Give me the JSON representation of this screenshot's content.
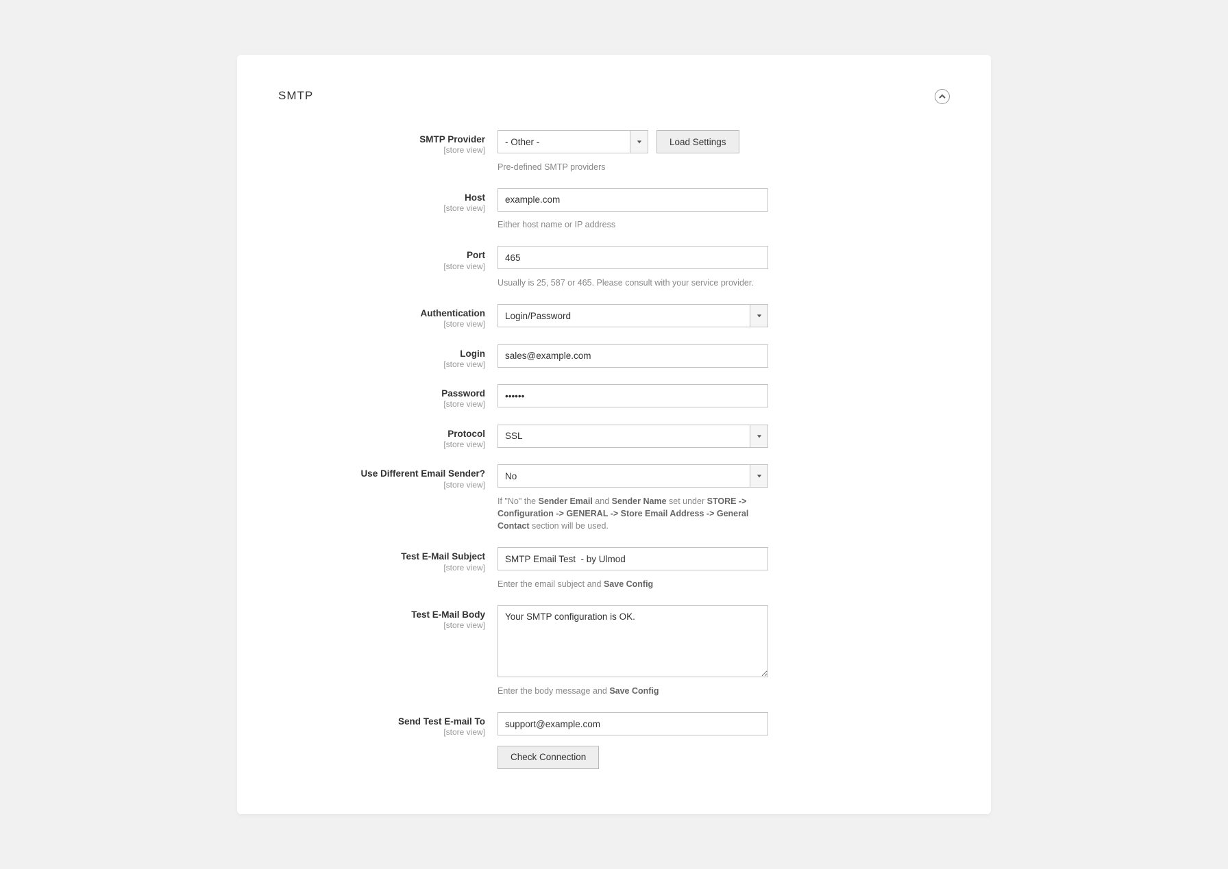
{
  "section": {
    "title": "SMTP"
  },
  "scope_label": "[store view]",
  "fields": {
    "provider": {
      "label": "SMTP Provider",
      "value": "- Other -",
      "help": "Pre-defined SMTP providers",
      "load_button": "Load Settings"
    },
    "host": {
      "label": "Host",
      "value": "example.com",
      "help": "Either host name or IP address"
    },
    "port": {
      "label": "Port",
      "value": "465",
      "help": "Usually is 25, 587 or 465. Please consult with your service provider."
    },
    "auth": {
      "label": "Authentication",
      "value": "Login/Password"
    },
    "login": {
      "label": "Login",
      "value": "sales@example.com"
    },
    "password": {
      "label": "Password",
      "value": "••••••"
    },
    "protocol": {
      "label": "Protocol",
      "value": "SSL"
    },
    "different_sender": {
      "label": "Use Different Email Sender?",
      "value": "No",
      "help_pre": "If \"No\" the ",
      "help_b1": "Sender Email",
      "help_mid1": " and ",
      "help_b2": "Sender Name",
      "help_mid2": " set under ",
      "help_b3": "STORE -> Configuration -> GENERAL -> Store Email Address -> General Contact",
      "help_post": " section will be used."
    },
    "test_subject": {
      "label": "Test E-Mail Subject",
      "value": "SMTP Email Test  - by Ulmod",
      "help_pre": "Enter the email subject and ",
      "help_b": "Save Config"
    },
    "test_body": {
      "label": "Test E-Mail Body",
      "value": "Your SMTP configuration is OK.",
      "help_pre": "Enter the body message and ",
      "help_b": "Save Config"
    },
    "send_to": {
      "label": "Send Test E-mail To",
      "value": "support@example.com"
    },
    "check_button": "Check Connection"
  }
}
